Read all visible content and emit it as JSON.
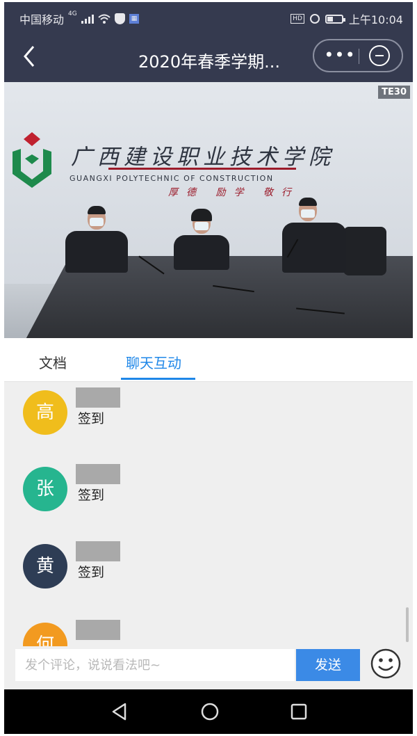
{
  "status_bar": {
    "carrier": "中国移动",
    "network": "4G",
    "time": "上午10:04",
    "hd_badge": "HD"
  },
  "header": {
    "title": "2020年春季学期...",
    "back_icon": "chevron-left-icon",
    "more_label": "•••",
    "close_icon": "minus-circle-icon",
    "background": "#353a4f"
  },
  "video": {
    "overlay_tag": "TE30",
    "school_name_cn": "广西建设职业技术学院",
    "school_name_en": "GUANGXI POLYTECHNIC OF CONSTRUCTION",
    "motto": "厚德 励学 敬行"
  },
  "tabs": [
    {
      "label": "文档",
      "active": false
    },
    {
      "label": "聊天互动",
      "active": true
    }
  ],
  "accent_color": "#1f87e8",
  "messages": [
    {
      "avatar_char": "高",
      "avatar_color": "#f0bd1c",
      "text": "签到"
    },
    {
      "avatar_char": "张",
      "avatar_color": "#26b58f",
      "text": "签到"
    },
    {
      "avatar_char": "黄",
      "avatar_color": "#2e3d55",
      "text": "签到"
    },
    {
      "avatar_char": "何",
      "avatar_color": "#f29a20",
      "text": ""
    }
  ],
  "composer": {
    "placeholder": "发个评论，说说看法吧~",
    "send_label": "发送",
    "emoji_icon": "smiley-icon"
  },
  "nav_bar": {
    "back_icon": "triangle-back-icon",
    "home_icon": "circle-home-icon",
    "recents_icon": "square-recents-icon"
  }
}
